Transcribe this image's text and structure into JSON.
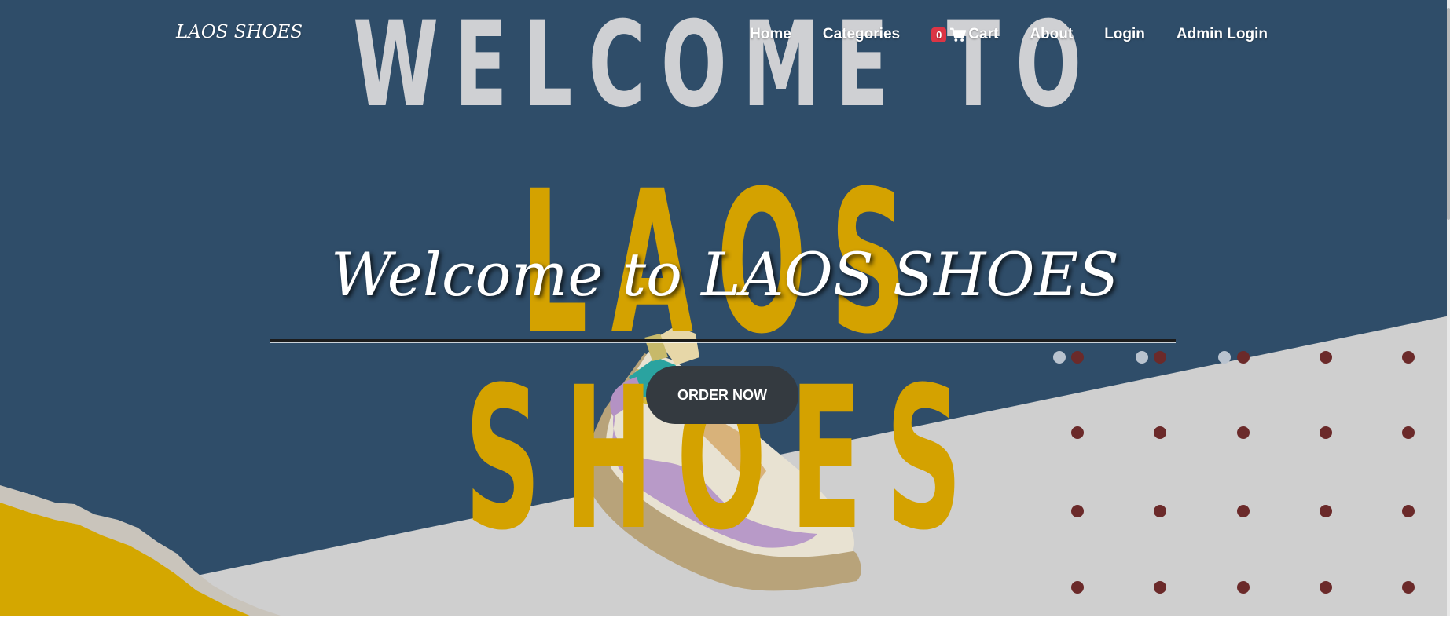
{
  "navbar": {
    "brand": "LAOS SHOES",
    "links": {
      "home": "Home",
      "categories": "Categories",
      "cart_count": "0",
      "cart": "Cart",
      "about": "About",
      "login": "Login",
      "admin_login": "Admin Login"
    }
  },
  "hero": {
    "banner_top": "WELCOME TO",
    "banner_main": "LAOS SHOES",
    "title": "Welcome to LAOS SHOES",
    "cta": "ORDER NOW"
  },
  "colors": {
    "background": "#2f4d69",
    "banner_top": "#cfd0d3",
    "banner_main": "#d4a200",
    "button": "#343a40",
    "badge": "#dc3545",
    "dots": "#6b2a2a"
  },
  "icons": [
    "cart-icon"
  ]
}
